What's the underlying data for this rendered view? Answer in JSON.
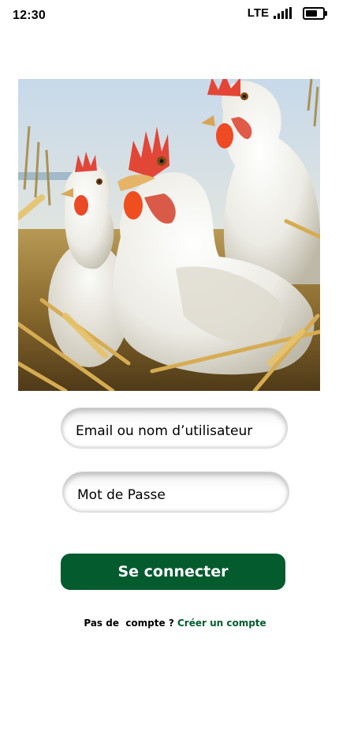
{
  "status_bar": {
    "time": "12:30",
    "network": "LTE",
    "battery_level": 0.7
  },
  "hero": {
    "icon": "hens-photo"
  },
  "login_form": {
    "email_placeholder": "Email ou nom d’utilisateur",
    "email_value": "",
    "password_placeholder": "Mot de Passe",
    "password_value": "",
    "submit_label": "Se connecter"
  },
  "signup": {
    "prompt": "Pas de  compte ? ",
    "link_label": "Créer un compte"
  },
  "colors": {
    "brand_green": "#035b2e",
    "background": "#ffffff"
  }
}
